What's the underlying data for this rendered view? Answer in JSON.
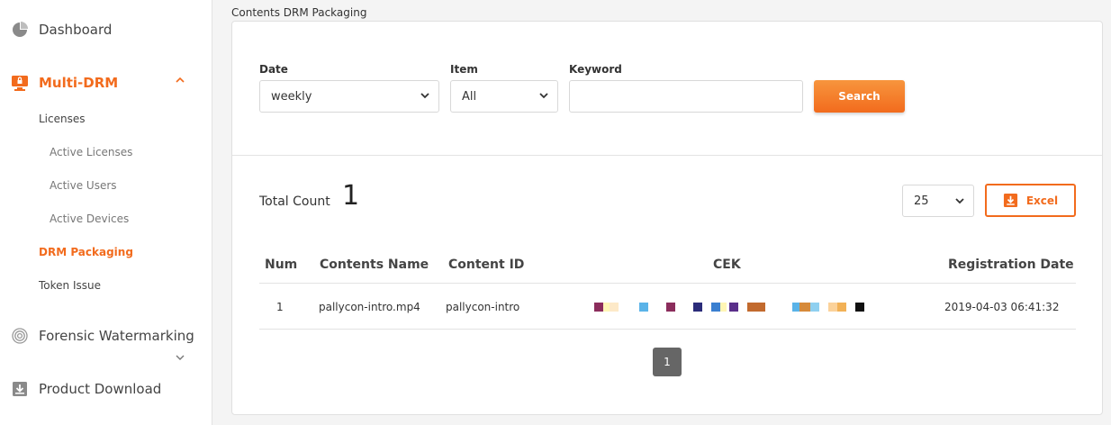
{
  "sidebar": {
    "dashboard": "Dashboard",
    "multi_drm": "Multi-DRM",
    "licenses": "Licenses",
    "active_licenses": "Active Licenses",
    "active_users": "Active Users",
    "active_devices": "Active Devices",
    "drm_packaging": "DRM Packaging",
    "token_issue": "Token Issue",
    "forensic": "Forensic Watermarking",
    "product_download": "Product Download",
    "chevron_up": "⌃",
    "chevron_down": "⌄"
  },
  "breadcrumb": "Contents DRM Packaging",
  "filters": {
    "date_label": "Date",
    "date_value": "weekly",
    "item_label": "Item",
    "item_value": "All",
    "keyword_label": "Keyword",
    "keyword_value": "",
    "keyword_placeholder": "",
    "search_label": "Search"
  },
  "results": {
    "total_label": "Total Count",
    "total_value": "1",
    "page_size": "25",
    "excel_label": "Excel"
  },
  "table": {
    "headers": {
      "num": "Num",
      "name": "Contents Name",
      "id": "Content ID",
      "cek": "CEK",
      "date": "Registration Date"
    },
    "rows": [
      {
        "num": "1",
        "name": "pallycon-intro.mp4",
        "id": "pallycon-intro",
        "date": "2019-04-03 06:41:32"
      }
    ]
  },
  "pagination": {
    "current": "1"
  },
  "colors": {
    "accent": "#f26b1d",
    "cek_blocks": [
      "#8b2d5c",
      "#fff6b5",
      "#fde9c8",
      "#5ab3e8",
      "#8b2d5c",
      "#2b2c7a",
      "#3a7fd0",
      "#fff6b5",
      "#5a2f8a",
      "#c26a2e",
      "#c26a2e",
      "#5ab3e8",
      "#d68a3a",
      "#8fd0f0",
      "#fbd29a",
      "#f2b156",
      "#111111"
    ]
  },
  "icons": {
    "dashboard": "pie-chart-icon",
    "multi_drm": "monitor-lock-icon",
    "forensic": "fingerprint-icon",
    "download": "download-box-icon",
    "excel": "download-box-icon"
  }
}
